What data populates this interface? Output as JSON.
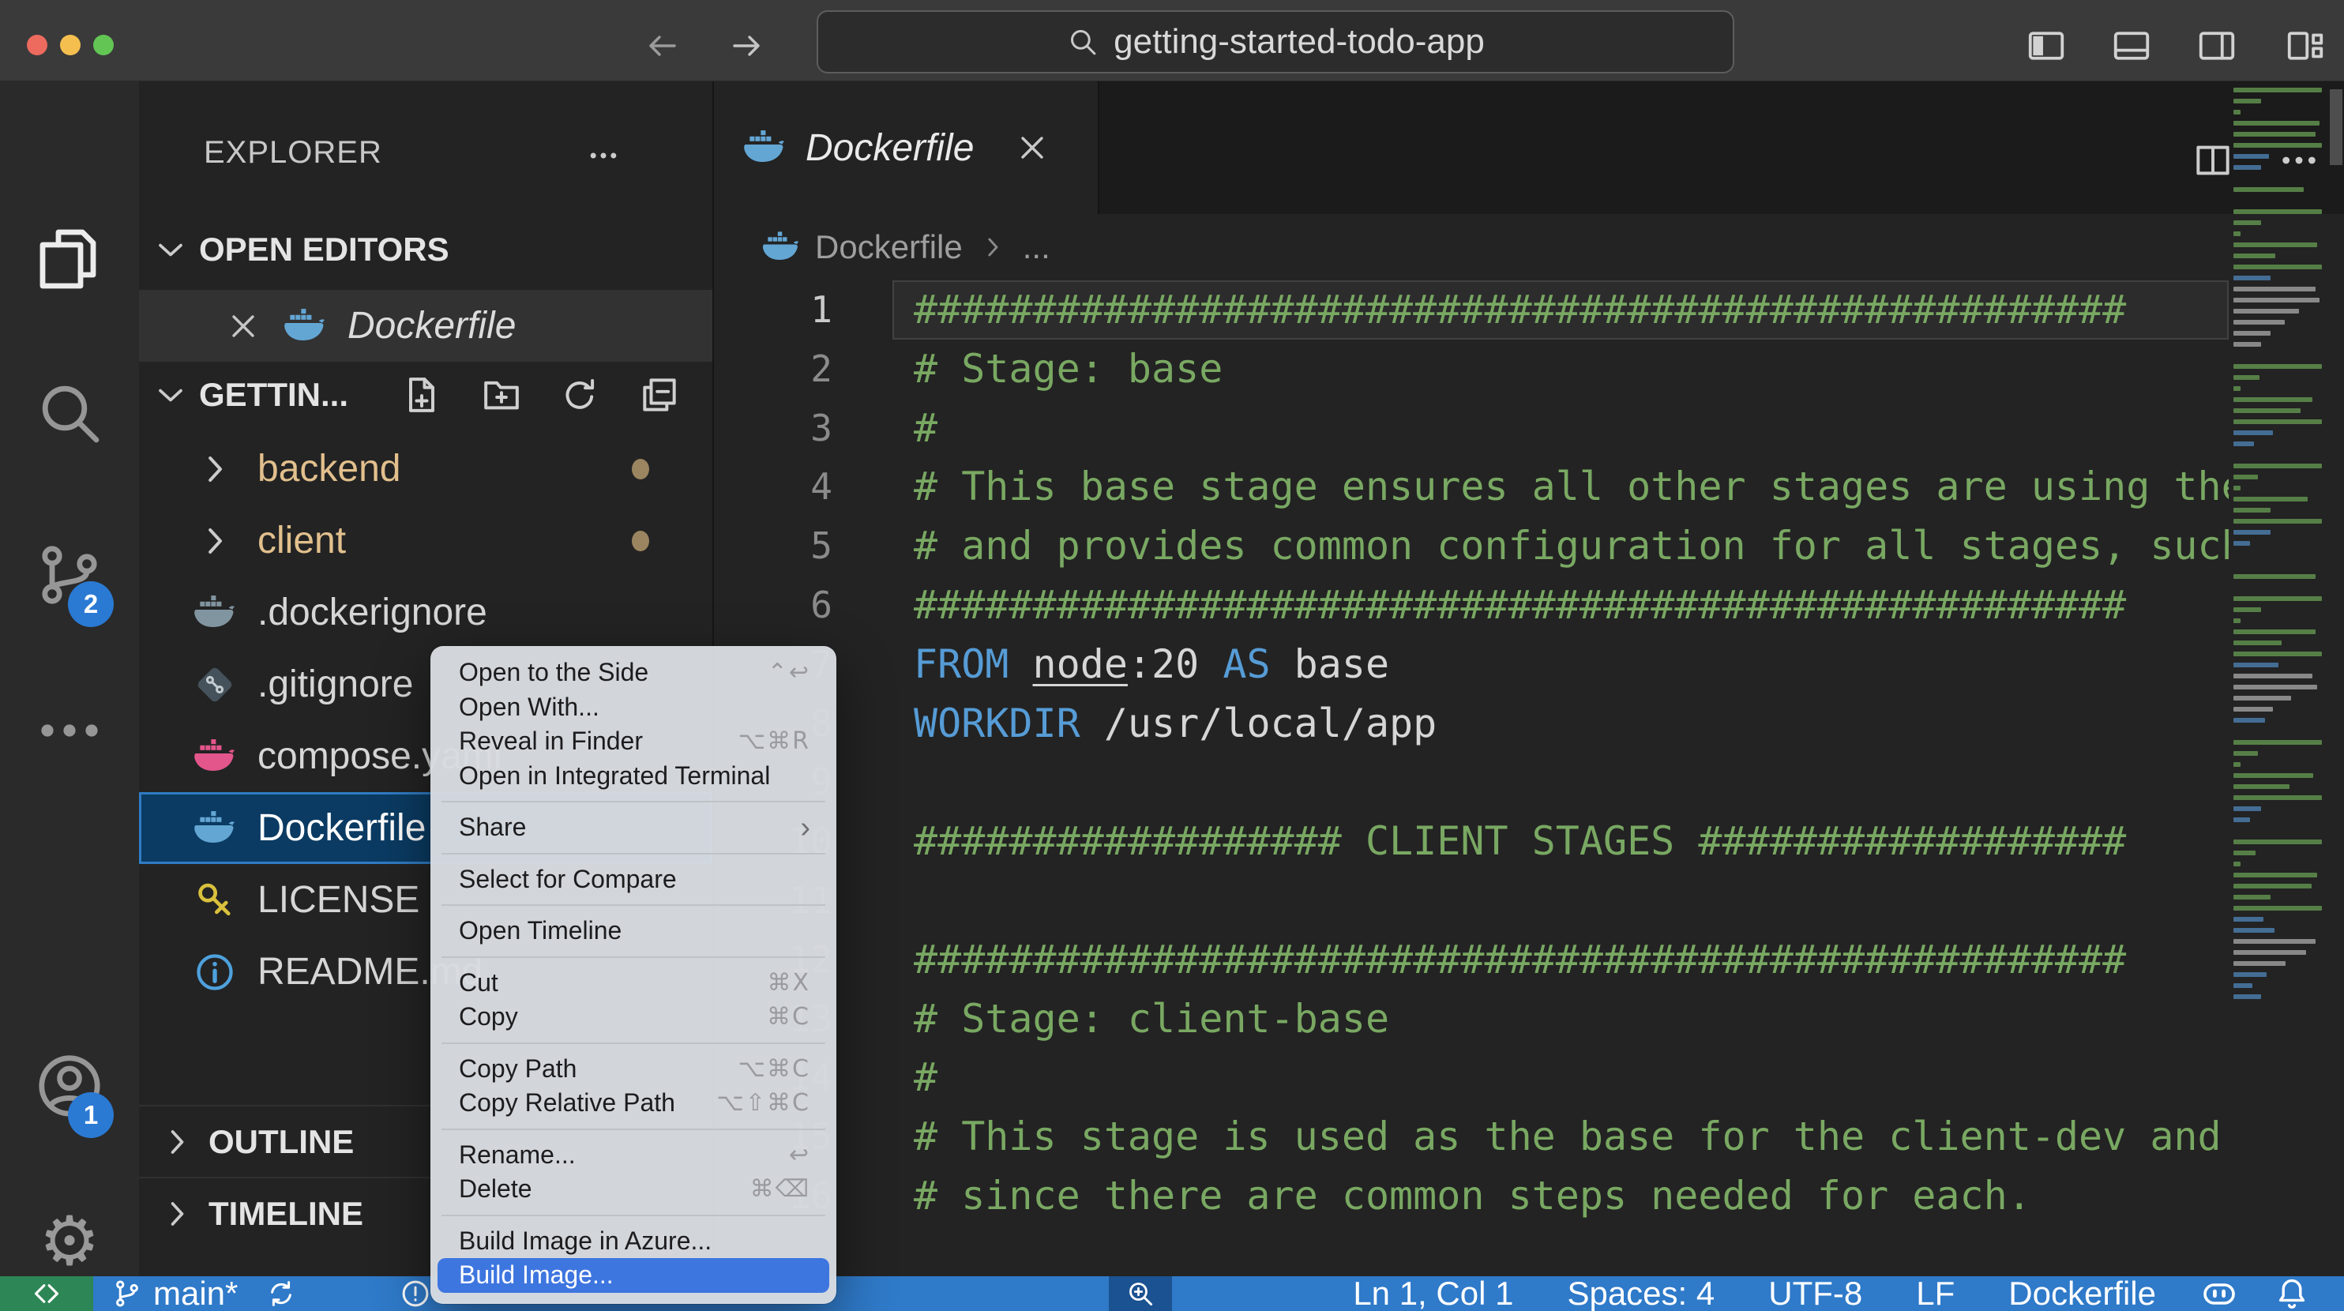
{
  "title_bar": {
    "search_value": "getting-started-todo-app",
    "traffic_lights": {
      "close": "#ed6a5e",
      "minimize": "#f5bf4f",
      "zoom": "#62c554"
    }
  },
  "activity_bar": {
    "scm_badge": "2",
    "account_badge": "1"
  },
  "sidebar": {
    "title": "EXPLORER",
    "open_editors_label": "OPEN EDITORS",
    "open_editor": {
      "name": "Dockerfile"
    },
    "section_label": "GETTIN...",
    "files": [
      {
        "label": "backend",
        "type": "folder",
        "modified": true
      },
      {
        "label": "client",
        "type": "folder",
        "modified": true
      },
      {
        "label": ".dockerignore",
        "icon": "whale-gray"
      },
      {
        "label": ".gitignore",
        "icon": "git"
      },
      {
        "label": "compose.yaml",
        "icon": "whale-pink"
      },
      {
        "label": "Dockerfile",
        "icon": "whale-blue",
        "selected": true
      },
      {
        "label": "LICENSE",
        "icon": "key"
      },
      {
        "label": "README.md",
        "icon": "info"
      }
    ],
    "outline_label": "OUTLINE",
    "timeline_label": "TIMELINE"
  },
  "editor": {
    "tab_label": "Dockerfile",
    "breadcrumb": {
      "file": "Dockerfile",
      "more": "..."
    },
    "lines": [
      {
        "current": true,
        "tokens": [
          [
            "c",
            "###################################################"
          ]
        ]
      },
      {
        "tokens": [
          [
            "c",
            "# Stage: base"
          ]
        ]
      },
      {
        "tokens": [
          [
            "c",
            "#"
          ]
        ]
      },
      {
        "tokens": [
          [
            "c",
            "# This base stage ensures all other stages are using the same base image"
          ]
        ]
      },
      {
        "tokens": [
          [
            "c",
            "# and provides common configuration for all stages, such as the working dir"
          ]
        ]
      },
      {
        "tokens": [
          [
            "c",
            "###################################################"
          ]
        ]
      },
      {
        "tokens": [
          [
            "k",
            "FROM "
          ],
          [
            "u",
            "node"
          ],
          [
            "t",
            ":20 "
          ],
          [
            "k",
            "AS "
          ],
          [
            "t",
            "base"
          ]
        ]
      },
      {
        "tokens": [
          [
            "k",
            "WORKDIR "
          ],
          [
            "t",
            "/usr/local/app"
          ]
        ]
      },
      {
        "tokens": []
      },
      {
        "tokens": [
          [
            "c",
            "################## CLIENT STAGES ##################"
          ]
        ]
      },
      {
        "tokens": []
      },
      {
        "tokens": [
          [
            "c",
            "###################################################"
          ]
        ]
      },
      {
        "tokens": [
          [
            "c",
            "# Stage: client-base"
          ]
        ]
      },
      {
        "tokens": [
          [
            "c",
            "#"
          ]
        ]
      },
      {
        "tokens": [
          [
            "c",
            "# This stage is used as the base for the client-dev and client-build stages,"
          ]
        ]
      },
      {
        "tokens": [
          [
            "c",
            "# since there are common steps needed for each."
          ]
        ]
      }
    ]
  },
  "context_menu": {
    "items": [
      {
        "label": "Open to the Side",
        "shortcut": "⌃↩"
      },
      {
        "label": "Open With..."
      },
      {
        "label": "Reveal in Finder",
        "shortcut": "⌥⌘R"
      },
      {
        "label": "Open in Integrated Terminal"
      },
      {
        "sep": true
      },
      {
        "label": "Share",
        "submenu": true
      },
      {
        "sep": true
      },
      {
        "label": "Select for Compare"
      },
      {
        "sep": true
      },
      {
        "label": "Open Timeline"
      },
      {
        "sep": true
      },
      {
        "label": "Cut",
        "shortcut": "⌘X"
      },
      {
        "label": "Copy",
        "shortcut": "⌘C"
      },
      {
        "sep": true
      },
      {
        "label": "Copy Path",
        "shortcut": "⌥⌘C"
      },
      {
        "label": "Copy Relative Path",
        "shortcut": "⌥⇧⌘C"
      },
      {
        "sep": true
      },
      {
        "label": "Rename...",
        "shortcut": "↩"
      },
      {
        "label": "Delete",
        "shortcut": "⌘⌫"
      },
      {
        "sep": true
      },
      {
        "label": "Build Image in Azure..."
      },
      {
        "label": "Build Image...",
        "highlighted": true
      }
    ]
  },
  "status_bar": {
    "branch": "main*",
    "right": [
      {
        "label": "Ln 1, Col 1"
      },
      {
        "label": "Spaces: 4"
      },
      {
        "label": "UTF-8"
      },
      {
        "label": "LF"
      },
      {
        "label": "Dockerfile"
      },
      {
        "icon": "copilot"
      },
      {
        "icon": "bell"
      }
    ]
  },
  "colors": {
    "status_blue": "#2f7ac9",
    "remote_green": "#2d8655",
    "selection_blue": "#0b3b63",
    "menu_highlight": "#3e76e0",
    "git_modified": "#E2C08D",
    "comment_green": "#79A862",
    "keyword_blue": "#569CD6"
  }
}
